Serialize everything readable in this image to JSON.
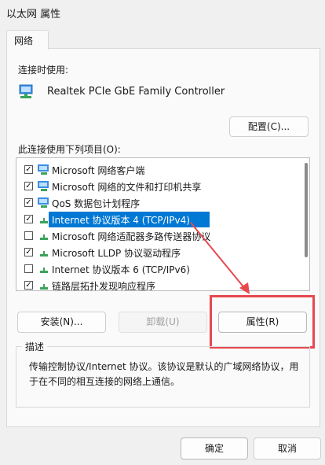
{
  "window": {
    "title": "以太网 属性"
  },
  "tabs": [
    {
      "label": "网络"
    }
  ],
  "connect_using": {
    "label": "连接时使用:",
    "adapter_name": "Realtek PCIe GbE Family Controller",
    "configure_button": "配置(C)..."
  },
  "items_section": {
    "label": "此连接使用下列项目(O):",
    "items": [
      {
        "label": "Microsoft 网络客户端",
        "checked": true,
        "icon": "network-client-icon"
      },
      {
        "label": "Microsoft 网络的文件和打印机共享",
        "checked": true,
        "icon": "network-client-icon"
      },
      {
        "label": "QoS 数据包计划程序",
        "checked": true,
        "icon": "network-client-icon"
      },
      {
        "label": "Internet 协议版本 4 (TCP/IPv4)",
        "checked": true,
        "icon": "protocol-icon",
        "selected": true
      },
      {
        "label": "Microsoft 网络适配器多路传送器协议",
        "checked": false,
        "icon": "protocol-icon"
      },
      {
        "label": "Microsoft LLDP 协议驱动程序",
        "checked": true,
        "icon": "protocol-icon"
      },
      {
        "label": "Internet 协议版本 6 (TCP/IPv6)",
        "checked": false,
        "icon": "protocol-icon"
      },
      {
        "label": "链路层拓扑发现响应程序",
        "checked": true,
        "icon": "protocol-icon"
      }
    ]
  },
  "item_buttons": {
    "install": "安装(N)...",
    "uninstall": "卸载(U)",
    "properties": "属性(R)"
  },
  "description": {
    "title": "描述",
    "text": "传输控制协议/Internet 协议。该协议是默认的广域网络协议，用于在不同的相互连接的网络上通信。"
  },
  "footer": {
    "ok": "确定",
    "cancel": "取消"
  },
  "colors": {
    "selection": "#0078d4",
    "annotation": "#e8484f"
  }
}
